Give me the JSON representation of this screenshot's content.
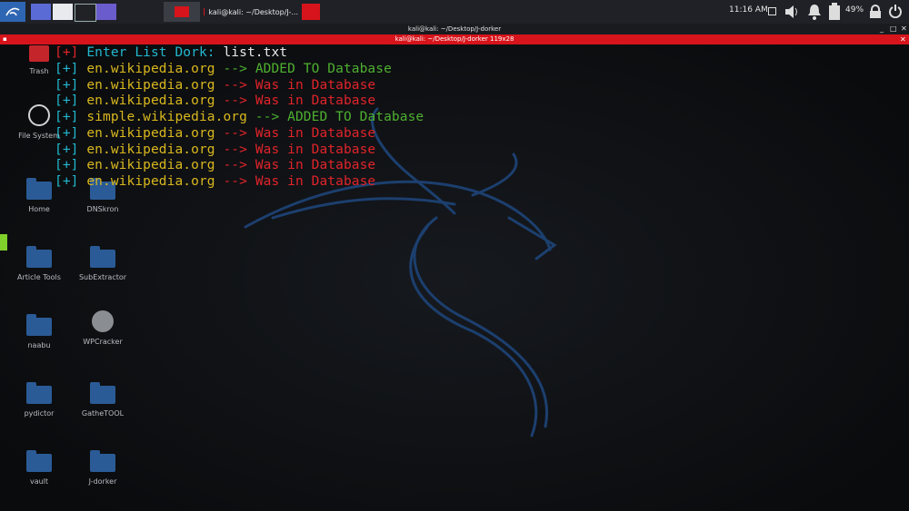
{
  "taskbar": {
    "clock": "11:16 AM",
    "battery": "49%",
    "active_window_label": "kali@kali: ~/Desktop/J-..."
  },
  "titlebar": {
    "outer": "kali@kali: ~/Desktop/J-dorker",
    "inner": "kali@kali: ~/Desktop/J-dorker 119x28"
  },
  "desktop_icons": [
    {
      "label": "Trash"
    },
    {
      "label": "File System"
    },
    {
      "label": "Home"
    },
    {
      "label": "DNSkron"
    },
    {
      "label": "Article Tools"
    },
    {
      "label": "SubExtractor"
    },
    {
      "label": "naabu"
    },
    {
      "label": "WPCracker"
    },
    {
      "label": "pydictor"
    },
    {
      "label": "GatheTOOL"
    },
    {
      "label": "vault"
    },
    {
      "label": "J-dorker"
    }
  ],
  "terminal": {
    "prompt": {
      "marker": "[+]",
      "text": "Enter List Dork:",
      "value": "list.txt"
    },
    "lines": [
      {
        "marker": "[+]",
        "domain": "en.wikipedia.org",
        "arrow": "-->",
        "status": "ADDED TO Database",
        "status_color": "green"
      },
      {
        "marker": "[+]",
        "domain": "en.wikipedia.org",
        "arrow": "-->",
        "status": "Was in Database",
        "status_color": "red"
      },
      {
        "marker": "[+]",
        "domain": "en.wikipedia.org",
        "arrow": "-->",
        "status": "Was in Database",
        "status_color": "red"
      },
      {
        "marker": "[+]",
        "domain": "simple.wikipedia.org",
        "arrow": "-->",
        "status": "ADDED TO Database",
        "status_color": "green"
      },
      {
        "marker": "[+]",
        "domain": "en.wikipedia.org",
        "arrow": "-->",
        "status": "Was in Database",
        "status_color": "red"
      },
      {
        "marker": "[+]",
        "domain": "en.wikipedia.org",
        "arrow": "-->",
        "status": "Was in Database",
        "status_color": "red"
      },
      {
        "marker": "[+]",
        "domain": "en.wikipedia.org",
        "arrow": "-->",
        "status": "Was in Database",
        "status_color": "red"
      },
      {
        "marker": "[+]",
        "domain": "en.wikipedia.org",
        "arrow": "-->",
        "status": "Was in Database",
        "status_color": "red"
      }
    ]
  },
  "colors": {
    "taskbar_bg": "#1f2126",
    "title_red": "#d7141b",
    "term_cyan": "#22b8cf",
    "term_yellow": "#d9b81e",
    "term_green": "#4eb030",
    "term_red": "#e0242a"
  }
}
